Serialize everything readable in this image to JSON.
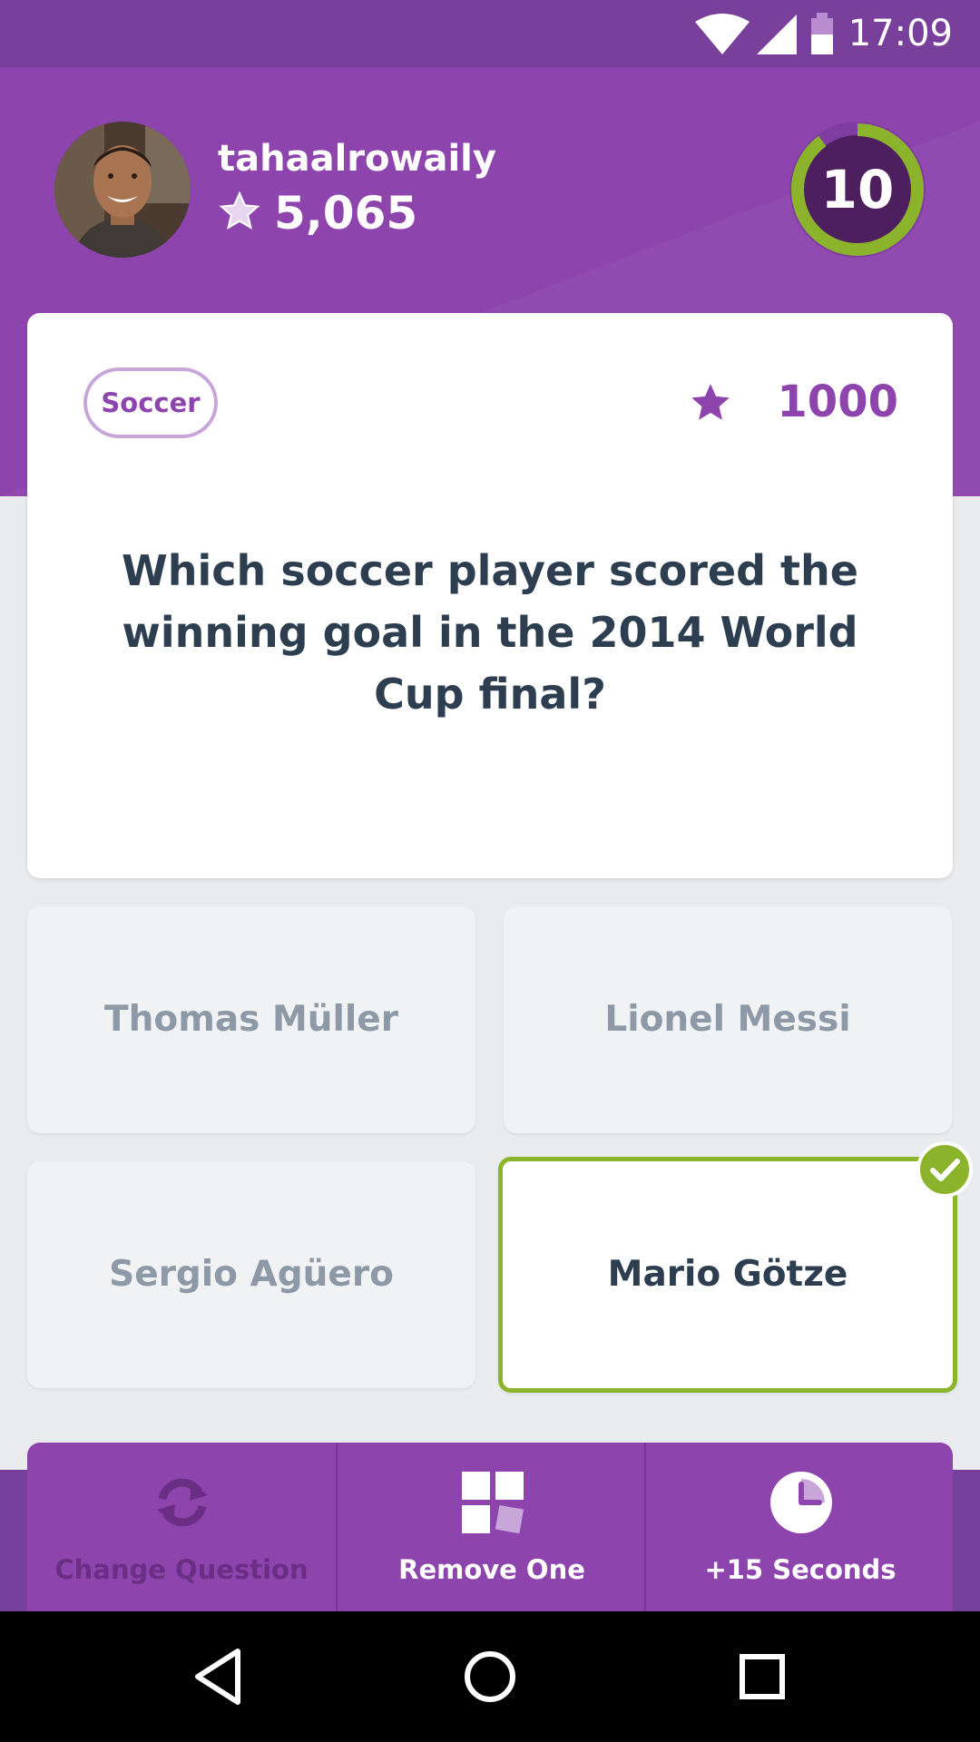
{
  "status_bar": {
    "time": "17:09",
    "icons": [
      "wifi-icon",
      "cell-signal-icon",
      "battery-icon"
    ]
  },
  "header": {
    "username": "tahaalrowaily",
    "score": "5,065",
    "timer": "10",
    "timer_progress": 0.9
  },
  "question": {
    "category": "Soccer",
    "points": "1000",
    "text": "Which soccer player scored the winning goal in the 2014 World Cup final?"
  },
  "answers": [
    {
      "label": "Thomas Müller",
      "state": "disabled"
    },
    {
      "label": "Lionel Messi",
      "state": "disabled"
    },
    {
      "label": "Sergio Agüero",
      "state": "disabled"
    },
    {
      "label": "Mario Götze",
      "state": "correct"
    }
  ],
  "powerups": [
    {
      "label": "Change Question",
      "icon": "refresh-icon",
      "enabled": false
    },
    {
      "label": "Remove One",
      "icon": "remove-one-icon",
      "enabled": true
    },
    {
      "label": "+15 Seconds",
      "icon": "clock-icon",
      "enabled": true
    }
  ],
  "nav_bar": {
    "icons": [
      "back-icon",
      "home-icon",
      "recent-apps-icon"
    ]
  },
  "colors": {
    "primary": "#8e44ad",
    "status_bar": "#78409a",
    "correct": "#8bb42c",
    "question_text": "#2c3e50",
    "disabled_text": "#8d99a6"
  }
}
